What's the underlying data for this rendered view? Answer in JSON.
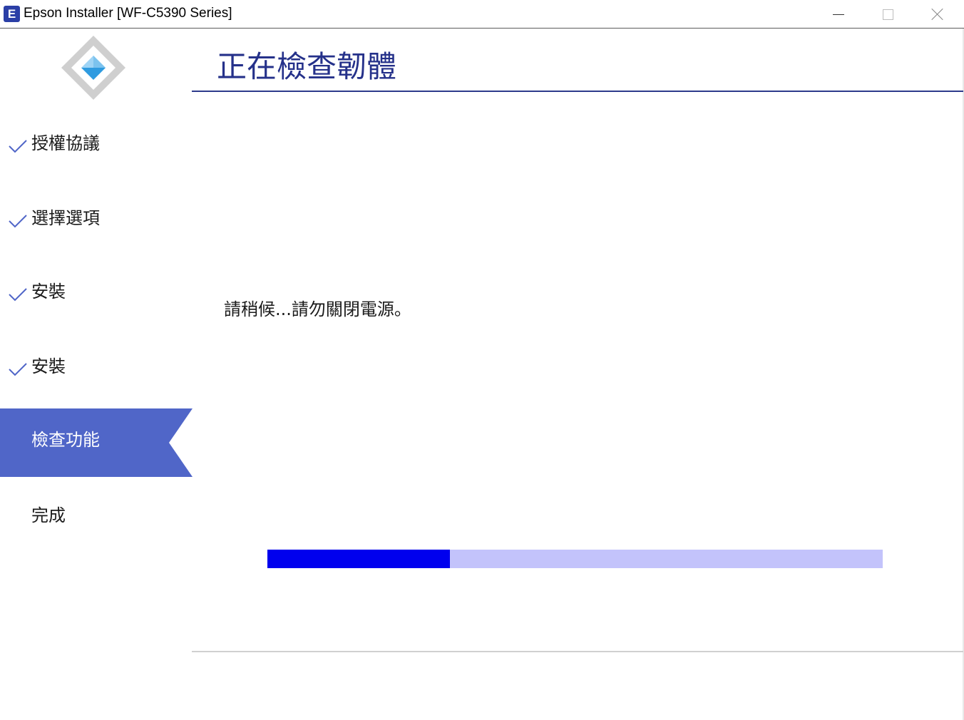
{
  "window": {
    "title": "Epson Installer [WF-C5390 Series]",
    "icon_letter": "E"
  },
  "sidebar": {
    "steps": [
      {
        "label": "授權協議",
        "state": "done"
      },
      {
        "label": "選擇選項",
        "state": "done"
      },
      {
        "label": "安裝",
        "state": "done"
      },
      {
        "label": "安裝",
        "state": "done"
      },
      {
        "label": "檢查功能",
        "state": "active"
      },
      {
        "label": "完成",
        "state": "pending"
      }
    ]
  },
  "main": {
    "title": "正在檢查韌體",
    "message": "請稍候...請勿關閉電源。",
    "progress": 0.297
  },
  "colors": {
    "accent": "#5066c8",
    "heading": "#25318a",
    "progress_fill": "#0000ee",
    "progress_track": "#c3c3fb",
    "check": "#5066c8"
  }
}
